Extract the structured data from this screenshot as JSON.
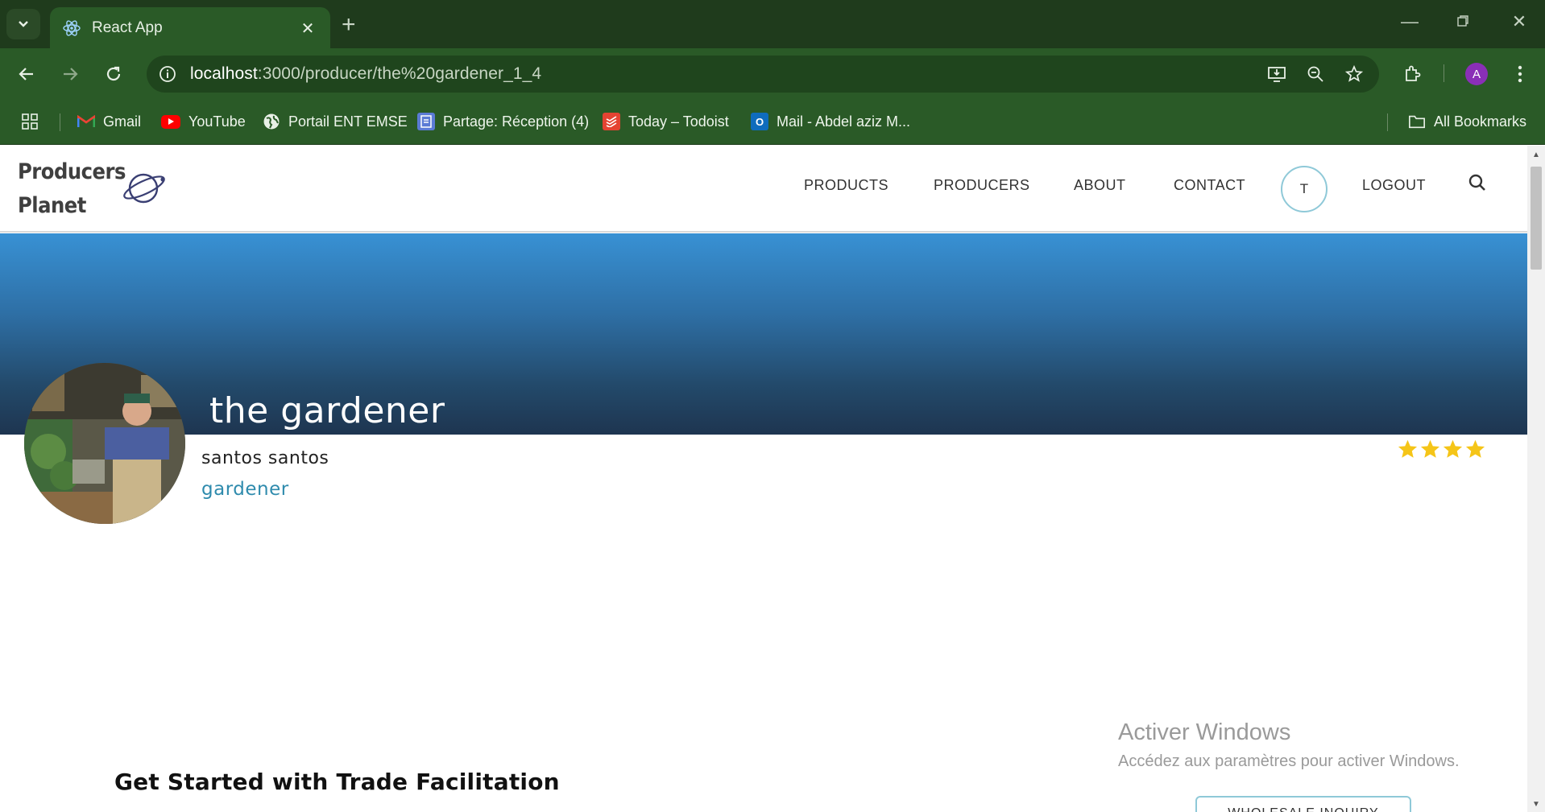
{
  "browser": {
    "tab_title": "React App",
    "new_tab_symbol": "+",
    "url_host": "localhost",
    "url_path": ":3000/producer/the%20gardener_1_4",
    "profile_initial": "A",
    "bookmarks": [
      {
        "label": "Gmail",
        "icon": "gmail-icon"
      },
      {
        "label": "YouTube",
        "icon": "youtube-icon"
      },
      {
        "label": "Portail ENT EMSE",
        "icon": "globe-icon"
      },
      {
        "label": "Partage: Réception (4)",
        "icon": "partage-icon"
      },
      {
        "label": "Today – Todoist",
        "icon": "todoist-icon"
      },
      {
        "label": "Mail - Abdel aziz M...",
        "icon": "outlook-icon"
      }
    ],
    "all_bookmarks_label": "All Bookmarks"
  },
  "site": {
    "logo_line1": "Producers",
    "logo_line2": "Planet",
    "nav": {
      "products": "PRODUCTS",
      "producers": "PRODUCERS",
      "about": "ABOUT",
      "contact": "CONTACT",
      "user_initial": "T",
      "logout": "LOGOUT"
    }
  },
  "producer": {
    "name": "the gardener",
    "owner": "santos santos",
    "type": "gardener",
    "rating": 4,
    "rating_color": "#f5c518"
  },
  "section": {
    "title": "Get Started with Trade Facilitation",
    "inquiry_button": "WHOLESALE INQUIRY"
  },
  "windows_overlay": {
    "title": "Activer Windows",
    "subtitle": "Accédez aux paramètres pour activer Windows."
  },
  "colors": {
    "chrome_dark": "#1f3b1c",
    "chrome_green": "#2a5a27",
    "hero_top": "#3891d4",
    "hero_bottom": "#1e3550",
    "accent": "#2f8bad"
  }
}
